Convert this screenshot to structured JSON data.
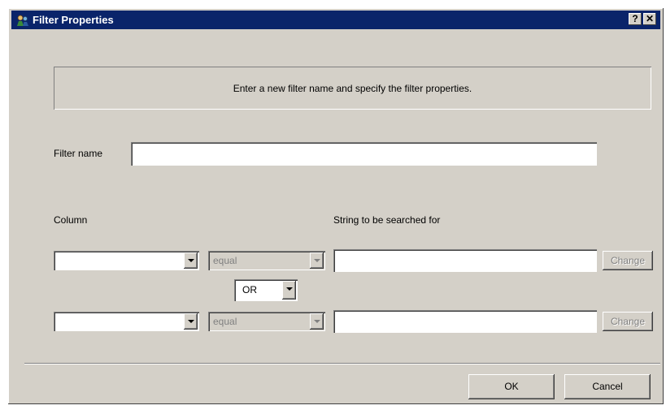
{
  "window": {
    "title": "Filter Properties",
    "help_button": "?",
    "close_button": "✕"
  },
  "info": {
    "text": "Enter a new filter name and specify the filter properties."
  },
  "filter_name": {
    "label": "Filter name",
    "value": ""
  },
  "headers": {
    "column": "Column",
    "search_string": "String to be searched for"
  },
  "rows": [
    {
      "column_value": "",
      "operator": "equal",
      "search_value": "",
      "change_label": "Change"
    },
    {
      "column_value": "",
      "operator": "equal",
      "search_value": "",
      "change_label": "Change"
    }
  ],
  "logic": {
    "selected": "OR"
  },
  "buttons": {
    "ok": "OK",
    "cancel": "Cancel"
  },
  "colors": {
    "titlebar": "#0a246a",
    "dialog": "#d4d0c8"
  }
}
